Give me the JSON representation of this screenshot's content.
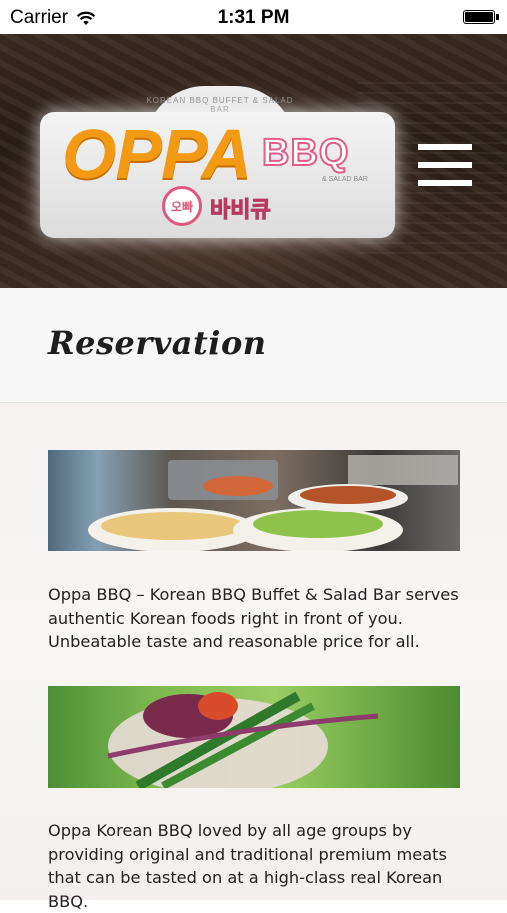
{
  "status_bar": {
    "carrier": "Carrier",
    "time": "1:31 PM"
  },
  "header": {
    "logo": {
      "arch_text": "KOREAN BBQ BUFFET & SALAD BAR",
      "name_primary": "OPPA",
      "name_secondary": "BBQ",
      "tagline": "& SALAD BAR",
      "badge_text": "오빠",
      "korean_text": "바비큐"
    },
    "menu_icon": "hamburger-menu-icon"
  },
  "page": {
    "title": "Reservation"
  },
  "content": {
    "paragraphs": [
      "Oppa BBQ – Korean BBQ Buffet & Salad Bar serves authentic Korean foods right in front of you. Unbeatable taste and reasonable price for all.",
      "Oppa Korean BBQ loved by all age groups by providing original and traditional premium meats that can be tasted on at a high-class real Korean BBQ."
    ]
  },
  "colors": {
    "logo_orange": "#f29a14",
    "logo_pink": "#e1567e",
    "title_text": "#1e1e1e",
    "body_text": "#222222"
  }
}
